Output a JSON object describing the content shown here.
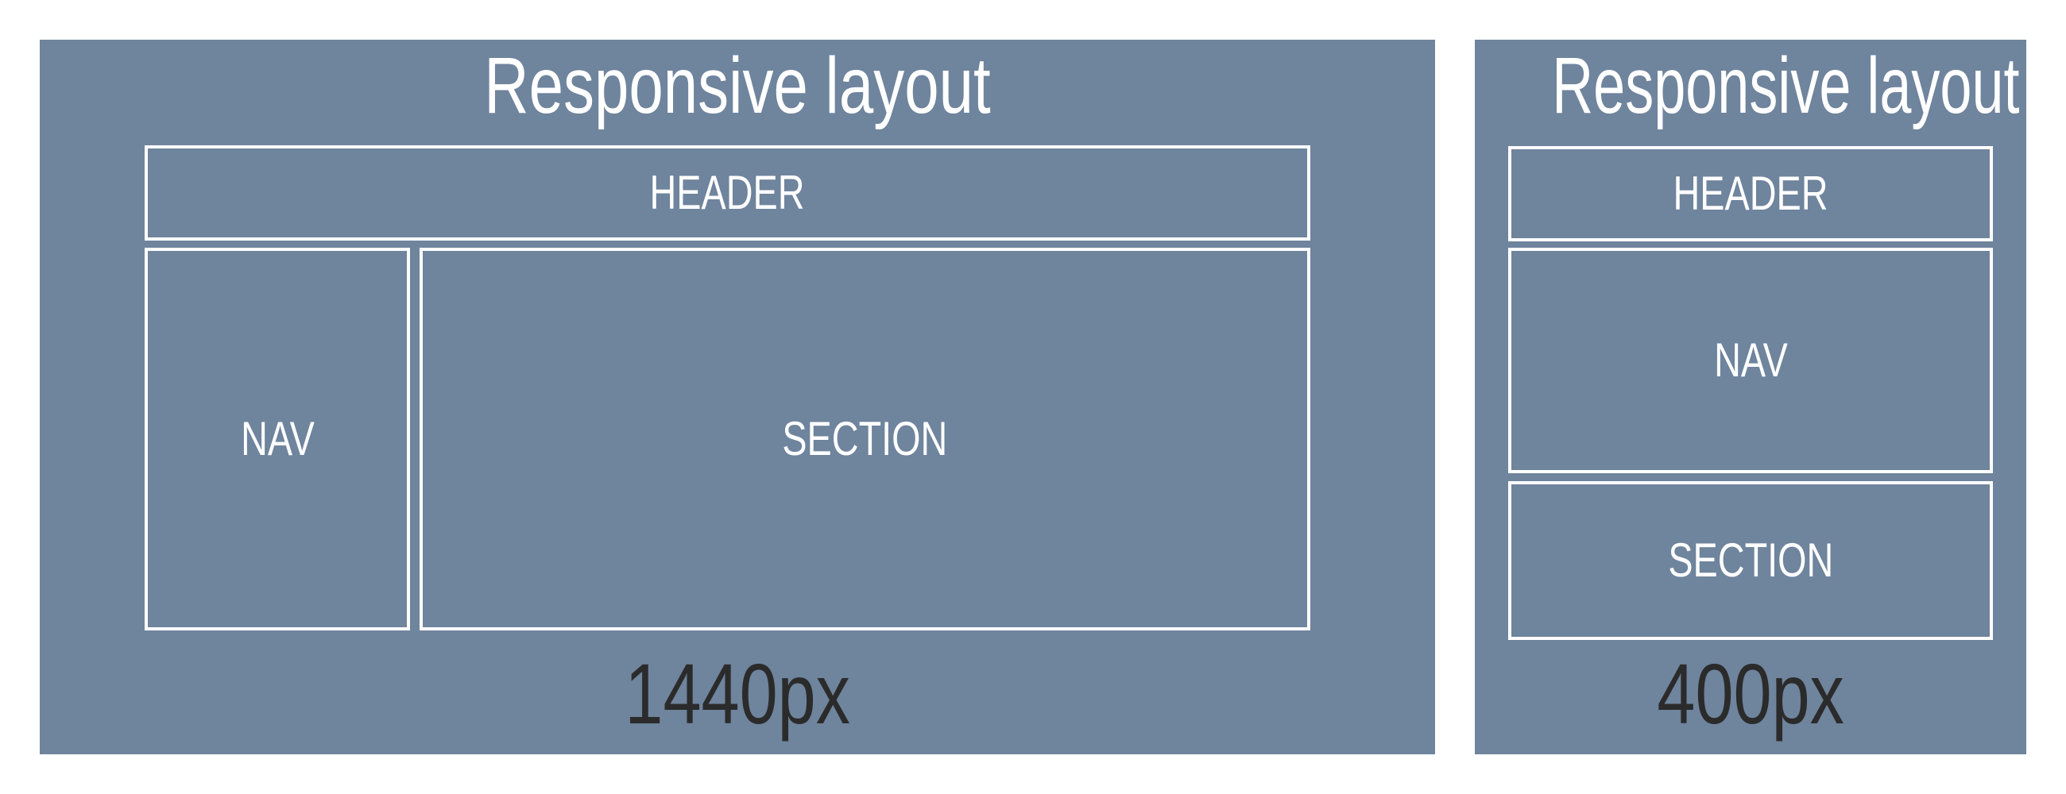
{
  "colors": {
    "panel_background": "#6f849d",
    "outline": "#ffffff",
    "width_label_text": "#2b2b2b",
    "page_background": "#ffffff"
  },
  "desktop": {
    "title": "Responsive layout",
    "header_label": "HEADER",
    "nav_label": "NAV",
    "section_label": "SECTION",
    "width_label": "1440px"
  },
  "mobile": {
    "title": "Responsive layout",
    "header_label": "HEADER",
    "nav_label": "NAV",
    "section_label": "SECTION",
    "width_label": "400px"
  }
}
